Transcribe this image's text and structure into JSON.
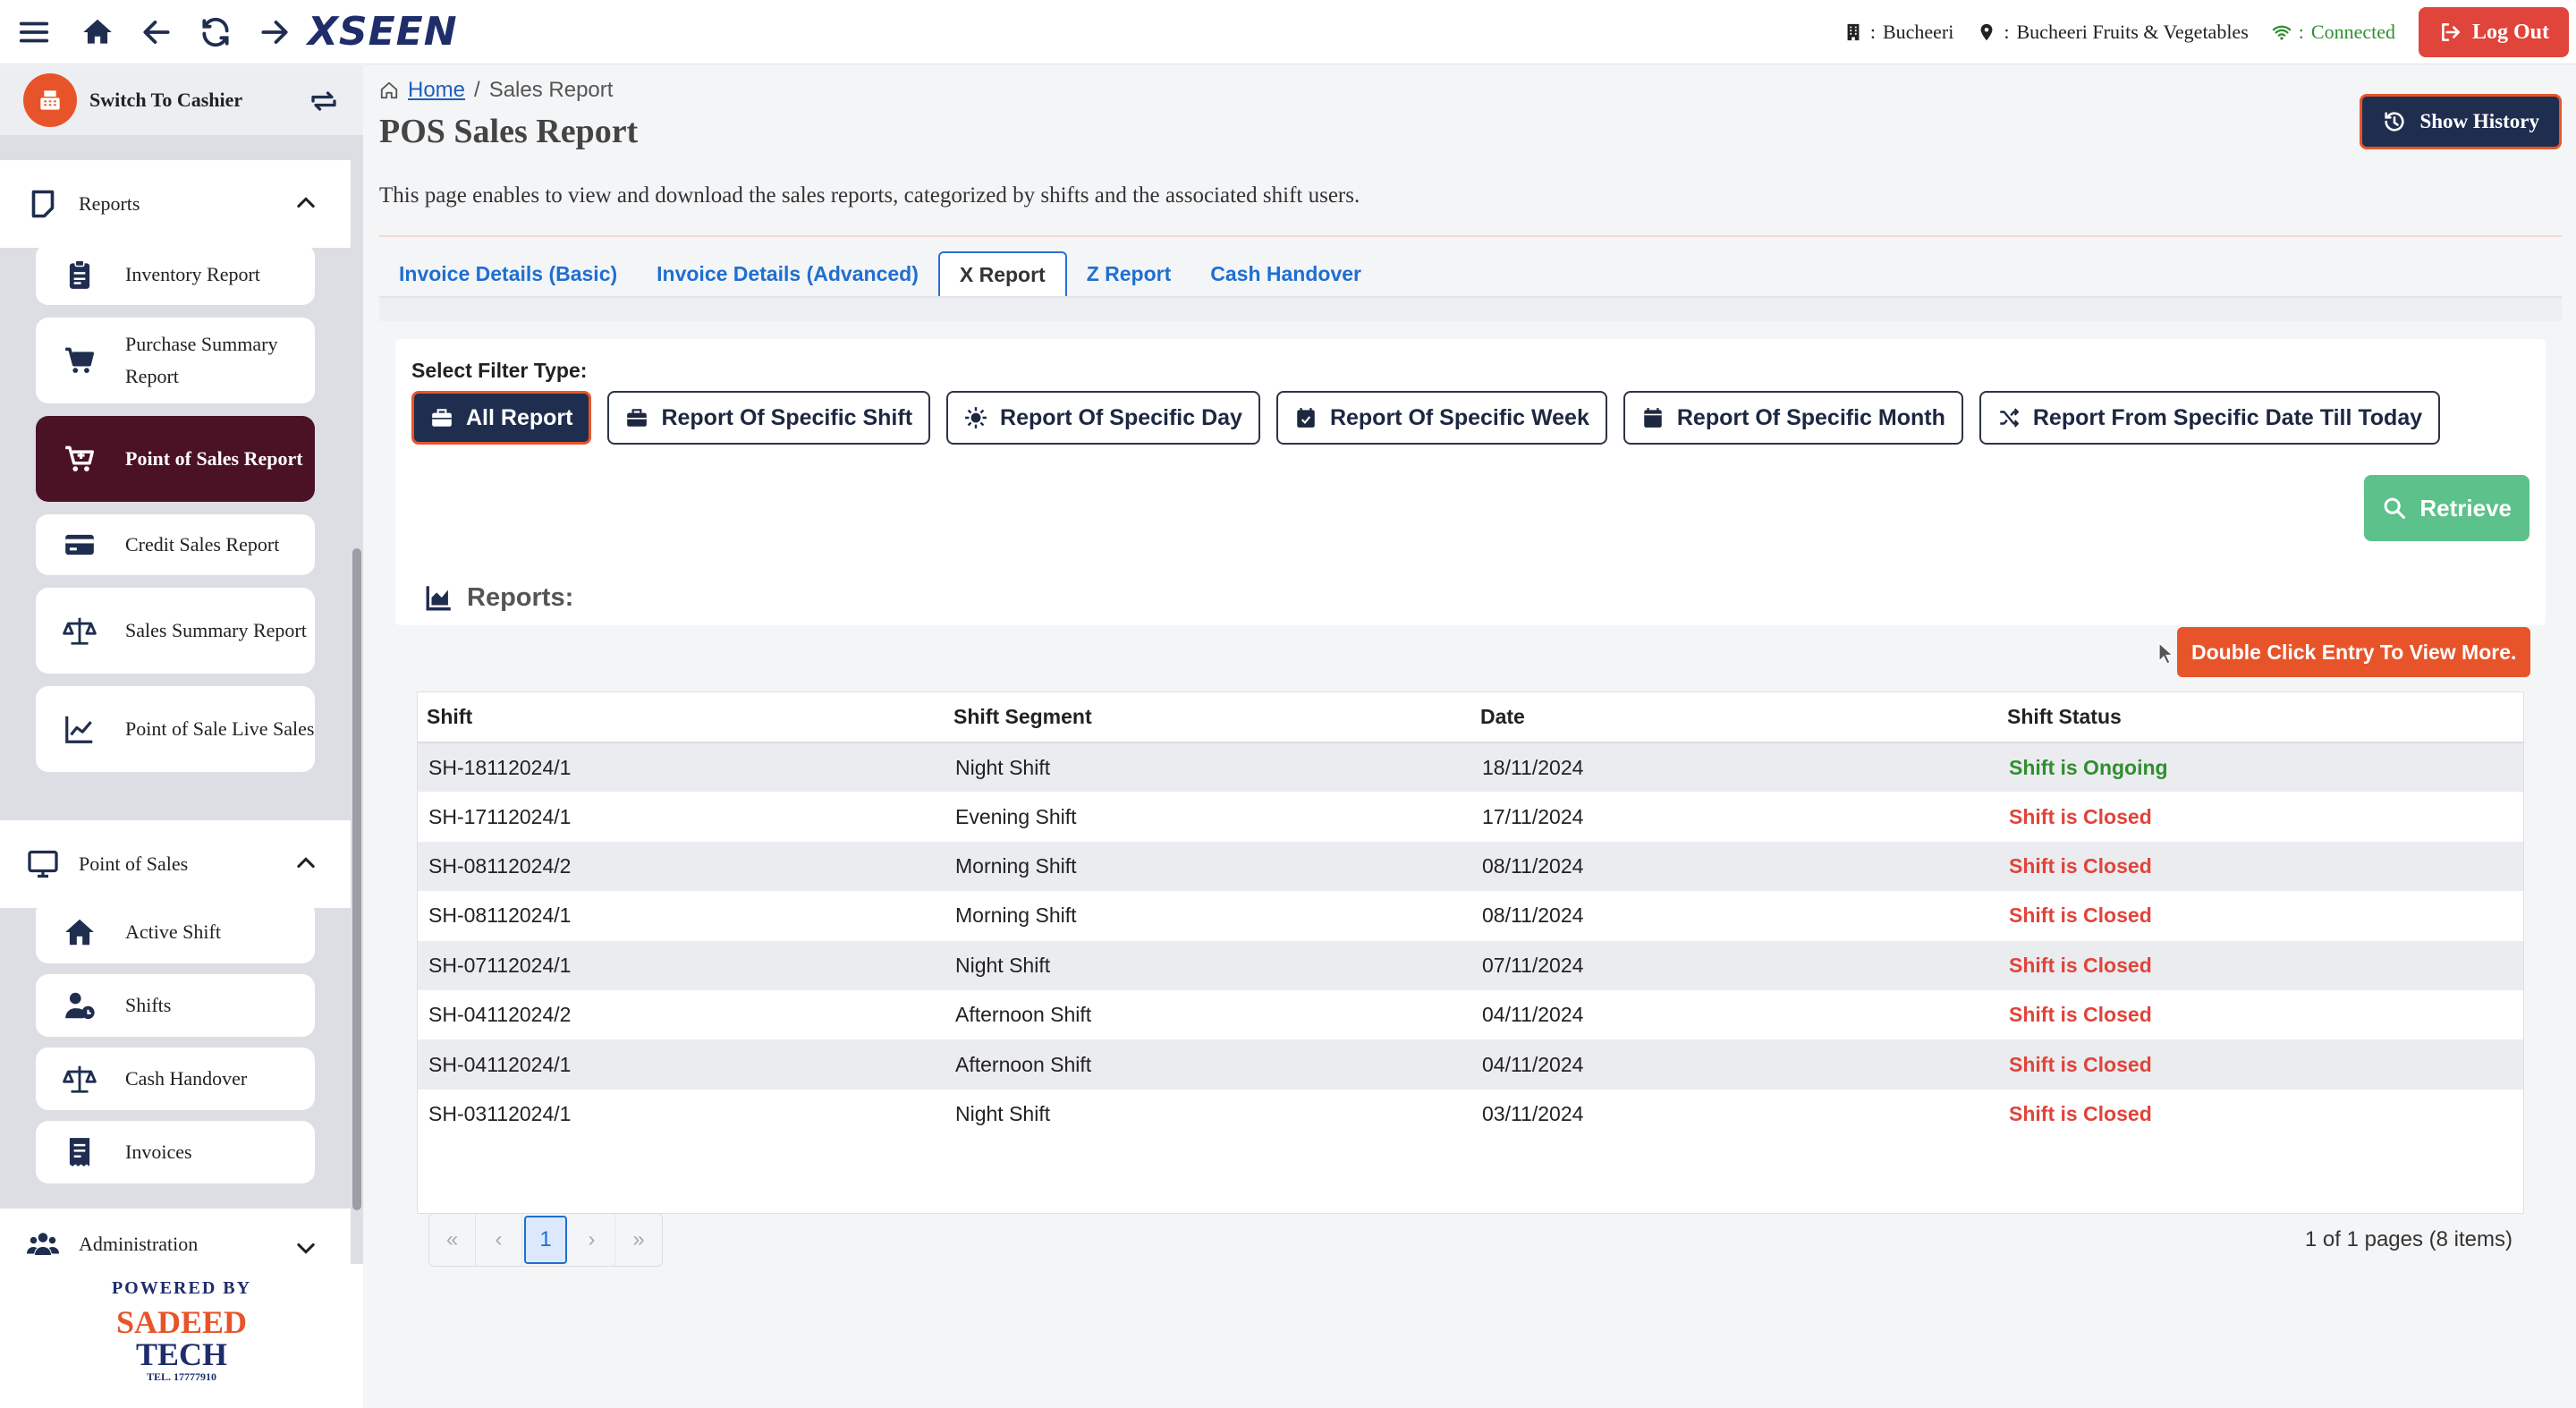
{
  "topbar": {
    "logo": "XSEEN",
    "branch_sep": ":",
    "branch": "Bucheeri",
    "location": "Bucheeri Fruits & Vegetables",
    "status": "Connected",
    "logout": "Log Out",
    "colors": {
      "accent": "#e8542a",
      "brand": "#1f2d6b",
      "connected": "#2f8f2f"
    }
  },
  "sidebar": {
    "switch_label": "Switch To Cashier",
    "reports_section": "Reports",
    "report_items": [
      {
        "label": "Inventory Report",
        "icon": "clipboard-icon"
      },
      {
        "label": "Purchase Summary Report",
        "icon": "cart-icon"
      },
      {
        "label": "Point of Sales Report",
        "icon": "cart-plus-icon"
      },
      {
        "label": "Credit Sales Report",
        "icon": "credit-card-icon"
      },
      {
        "label": "Sales Summary Report",
        "icon": "scale-icon"
      },
      {
        "label": "Point of Sale Live Sales",
        "icon": "line-chart-icon"
      }
    ],
    "pos_section": "Point of Sales",
    "pos_items": [
      {
        "label": "Active Shift",
        "icon": "home-icon"
      },
      {
        "label": "Shifts",
        "icon": "user-clock-icon"
      },
      {
        "label": "Cash Handover",
        "icon": "scale-icon"
      },
      {
        "label": "Invoices",
        "icon": "receipt-icon"
      }
    ],
    "admin_section": "Administration",
    "powered_by": "POWERED BY",
    "brand_line1": "SADEED",
    "brand_line2": "TECH",
    "brand_tel": "TEL. 17777910"
  },
  "main": {
    "breadcrumb": {
      "home": "Home",
      "sep": "/",
      "current": "Sales Report"
    },
    "title": "POS Sales Report",
    "history_button": "Show History",
    "description": "This page enables to view and download the sales reports, categorized by shifts and the associated shift users.",
    "tabs": [
      "Invoice Details (Basic)",
      "Invoice Details (Advanced)",
      "X Report",
      "Z Report",
      "Cash Handover"
    ],
    "active_tab": "X Report",
    "filter_label": "Select Filter Type:",
    "filters": [
      "All Report",
      "Report Of Specific Shift",
      "Report Of Specific Day",
      "Report Of Specific Week",
      "Report Of Specific Month",
      "Report From Specific Date Till Today"
    ],
    "retrieve": "Retrieve",
    "reports_title": "Reports:",
    "hint": "Double Click Entry To View More.",
    "columns": [
      "Shift",
      "Shift Segment",
      "Date",
      "Shift Status"
    ],
    "rows": [
      {
        "shift": "SH-18112024/1",
        "segment": "Night Shift",
        "date": "18/11/2024",
        "status": "Shift is Ongoing",
        "status_color": "#2f8f2f"
      },
      {
        "shift": "SH-17112024/1",
        "segment": "Evening Shift",
        "date": "17/11/2024",
        "status": "Shift is Closed",
        "status_color": "#e0443a"
      },
      {
        "shift": "SH-08112024/2",
        "segment": "Morning Shift",
        "date": "08/11/2024",
        "status": "Shift is Closed",
        "status_color": "#e0443a"
      },
      {
        "shift": "SH-08112024/1",
        "segment": "Morning Shift",
        "date": "08/11/2024",
        "status": "Shift is Closed",
        "status_color": "#e0443a"
      },
      {
        "shift": "SH-07112024/1",
        "segment": "Night Shift",
        "date": "07/11/2024",
        "status": "Shift is Closed",
        "status_color": "#e0443a"
      },
      {
        "shift": "SH-04112024/2",
        "segment": "Afternoon Shift",
        "date": "04/11/2024",
        "status": "Shift is Closed",
        "status_color": "#e0443a"
      },
      {
        "shift": "SH-04112024/1",
        "segment": "Afternoon Shift",
        "date": "04/11/2024",
        "status": "Shift is Closed",
        "status_color": "#e0443a"
      },
      {
        "shift": "SH-03112024/1",
        "segment": "Night Shift",
        "date": "03/11/2024",
        "status": "Shift is Closed",
        "status_color": "#e0443a"
      }
    ],
    "pager": {
      "first": "«",
      "prev": "‹",
      "current": "1",
      "next": "›",
      "last": "»"
    },
    "page_info": "1 of 1 pages (8 items)"
  }
}
